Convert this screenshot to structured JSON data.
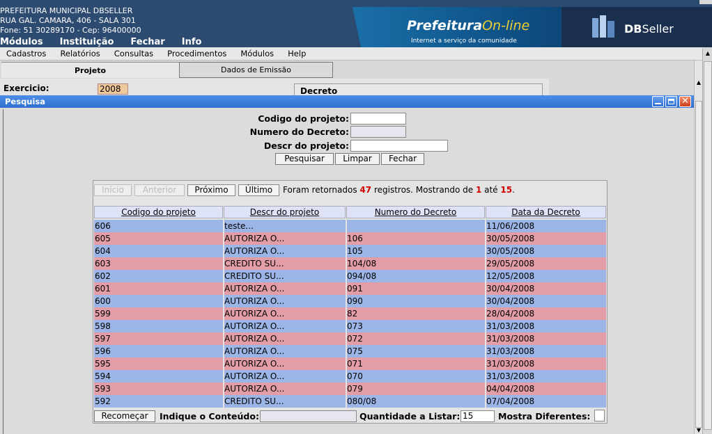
{
  "header": {
    "org_name": "PREFEITURA MUNICIPAL DBSELLER",
    "address": "RUA GAL. CAMARA, 406 - SALA 301",
    "contact": "Fone: 51 30289170  -  Cep: 96400000",
    "top_menu": [
      "Módulos",
      "Instituição",
      "Fechar",
      "Info"
    ],
    "brand_main": "Prefeitura",
    "brand_online": "On-line",
    "brand_sub": "Internet a serviço da comunidade",
    "dbs_bold": "DB",
    "dbs_lite": "Seller"
  },
  "menubar": [
    "Cadastros",
    "Relatórios",
    "Consultas",
    "Procedimentos",
    "Módulos",
    "Help"
  ],
  "tabs": [
    "Projeto",
    "Dados de Emissão"
  ],
  "form": {
    "exercicio_label": "Exercicio:",
    "exercicio_value": "2008",
    "decreto_label": "Decreto"
  },
  "dialog": {
    "title": "Pesquisa",
    "fields": {
      "codigo_label": "Codigo do projeto:",
      "codigo_value": "",
      "numero_label": "Numero do Decreto:",
      "numero_value": "",
      "descr_label": "Descr do projeto:",
      "descr_value": ""
    },
    "buttons": {
      "pesquisar": "Pesquisar",
      "limpar": "Limpar",
      "fechar": "Fechar"
    },
    "nav": {
      "inicio": "Início",
      "anterior": "Anterior",
      "proximo": "Próximo",
      "ultimo": "Último",
      "info_prefix": "Foram retornados ",
      "total": "47",
      "info_mid": " registros. Mostrando de ",
      "from": "1",
      "info_ate": " até ",
      "to": "15",
      "info_end": "."
    },
    "columns": [
      "Codigo do projeto",
      "Descr do projeto",
      "Numero do Decreto",
      "Data da Decreto"
    ],
    "rows": [
      [
        "606",
        "teste...",
        "",
        "11/06/2008"
      ],
      [
        "605",
        "AUTORIZA O...",
        "106",
        "30/05/2008"
      ],
      [
        "604",
        "AUTORIZA O...",
        "105",
        "30/05/2008"
      ],
      [
        "603",
        "CREDITO SU...",
        "104/08",
        "29/05/2008"
      ],
      [
        "602",
        "CREDITO SU...",
        "094/08",
        "12/05/2008"
      ],
      [
        "601",
        "AUTORIZA O...",
        "091",
        "30/04/2008"
      ],
      [
        "600",
        "AUTORIZA O...",
        "090",
        "30/04/2008"
      ],
      [
        "599",
        "AUTORIZA O...",
        "82",
        "28/04/2008"
      ],
      [
        "598",
        "AUTORIZA O...",
        "073",
        "31/03/2008"
      ],
      [
        "597",
        "AUTORIZA O...",
        "072",
        "31/03/2008"
      ],
      [
        "596",
        "AUTORIZA O...",
        "075",
        "31/03/2008"
      ],
      [
        "595",
        "AUTORIZA O...",
        "071",
        "31/03/2008"
      ],
      [
        "594",
        "AUTORIZA O...",
        "070",
        "31/03/2008"
      ],
      [
        "593",
        "AUTORIZA O...",
        "079",
        "04/04/2008"
      ],
      [
        "592",
        "CREDITO SU...",
        "080/08",
        "07/04/2008"
      ]
    ],
    "footer": {
      "recomecar": "Recomeçar",
      "conteudo_label": "Indique o Conteúdo:",
      "conteudo_value": "",
      "quantidade_label": "Quantidade a Listar:",
      "quantidade_value": "15",
      "mostra_label": "Mostra Diferentes:"
    }
  },
  "colors": {
    "row_blue": "#9ab5e6",
    "row_pink": "#e29da7",
    "title_bar": "#3a7cdc",
    "highlight_red": "#d00000"
  }
}
